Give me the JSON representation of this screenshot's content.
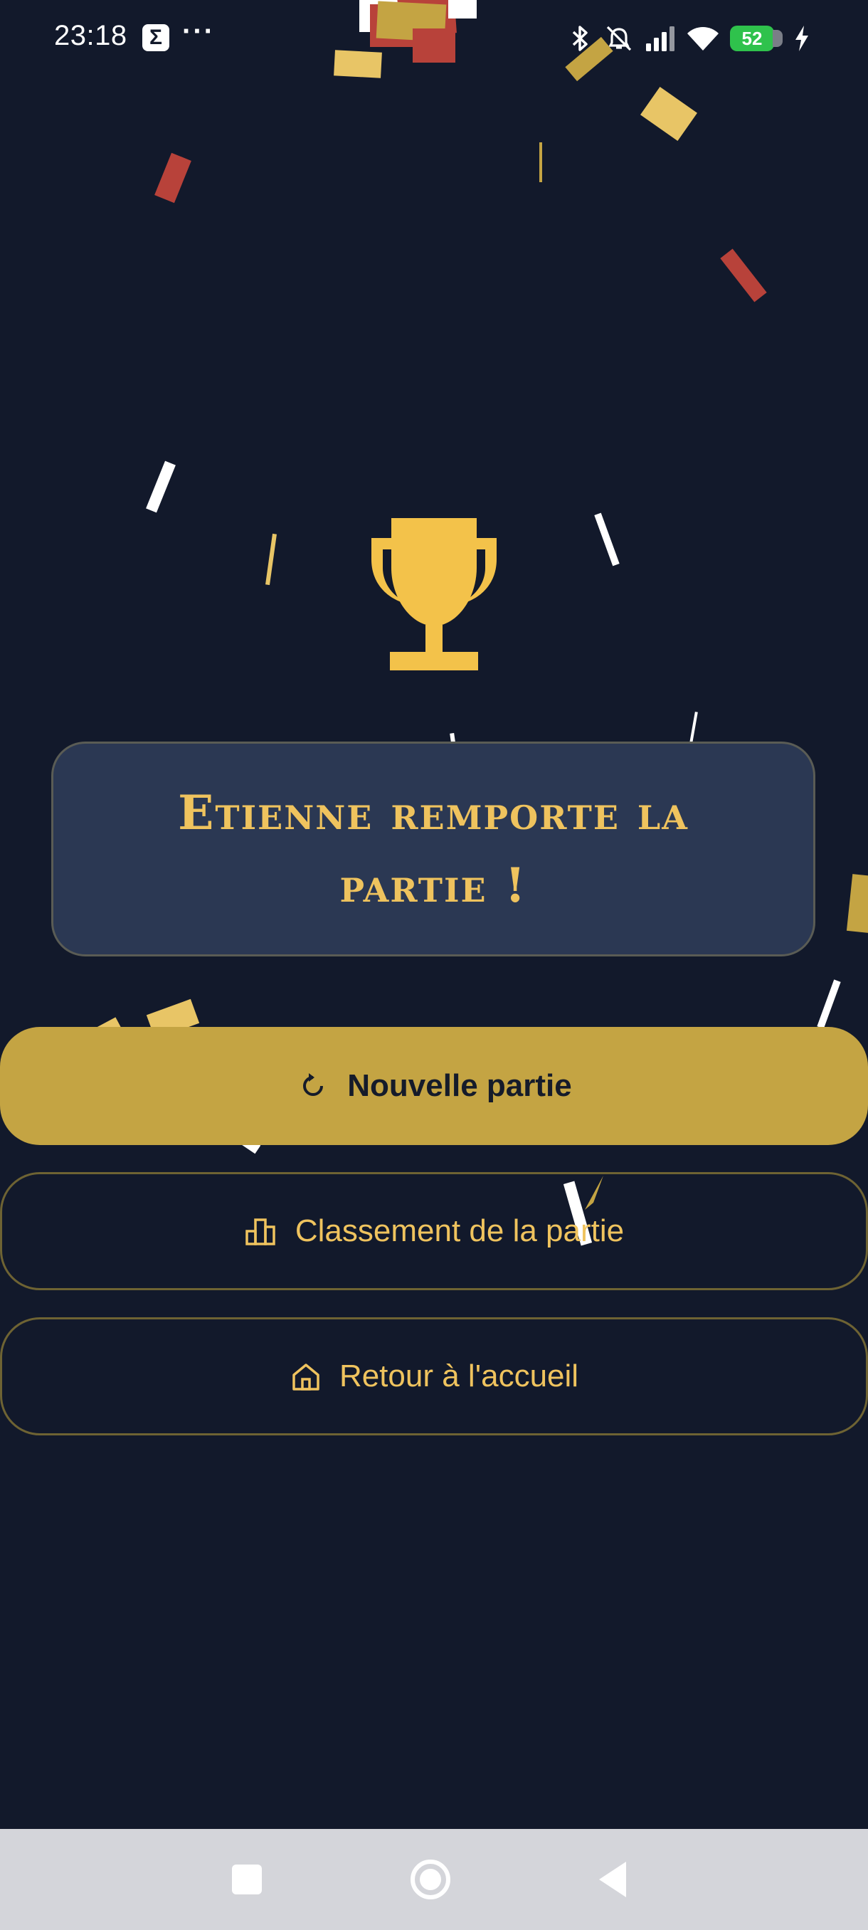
{
  "status_bar": {
    "time": "23:18",
    "app_icon": "Σ",
    "more": "···",
    "battery_level": "52",
    "icons": [
      "bluetooth-icon",
      "notifications-off-icon",
      "signal-icon",
      "wifi-icon",
      "battery-icon",
      "charging-icon"
    ]
  },
  "winner": {
    "message": "Etienne remporte la partie !"
  },
  "actions": {
    "new_game_label": "Nouvelle partie",
    "ranking_label": "Classement de la partie",
    "home_label": "Retour à l'accueil"
  },
  "nav_bar": {
    "buttons": [
      "recents-button",
      "home-button",
      "back-button"
    ]
  },
  "colors": {
    "background": "#12192b",
    "accent_gold": "#efc35e",
    "primary_button": "#c4a443",
    "card_background": "#2b3853",
    "confetti_red": "#b8423a",
    "confetti_gold": "#c4a443",
    "confetti_light_gold": "#e8c566",
    "confetti_white": "#ffffff"
  }
}
